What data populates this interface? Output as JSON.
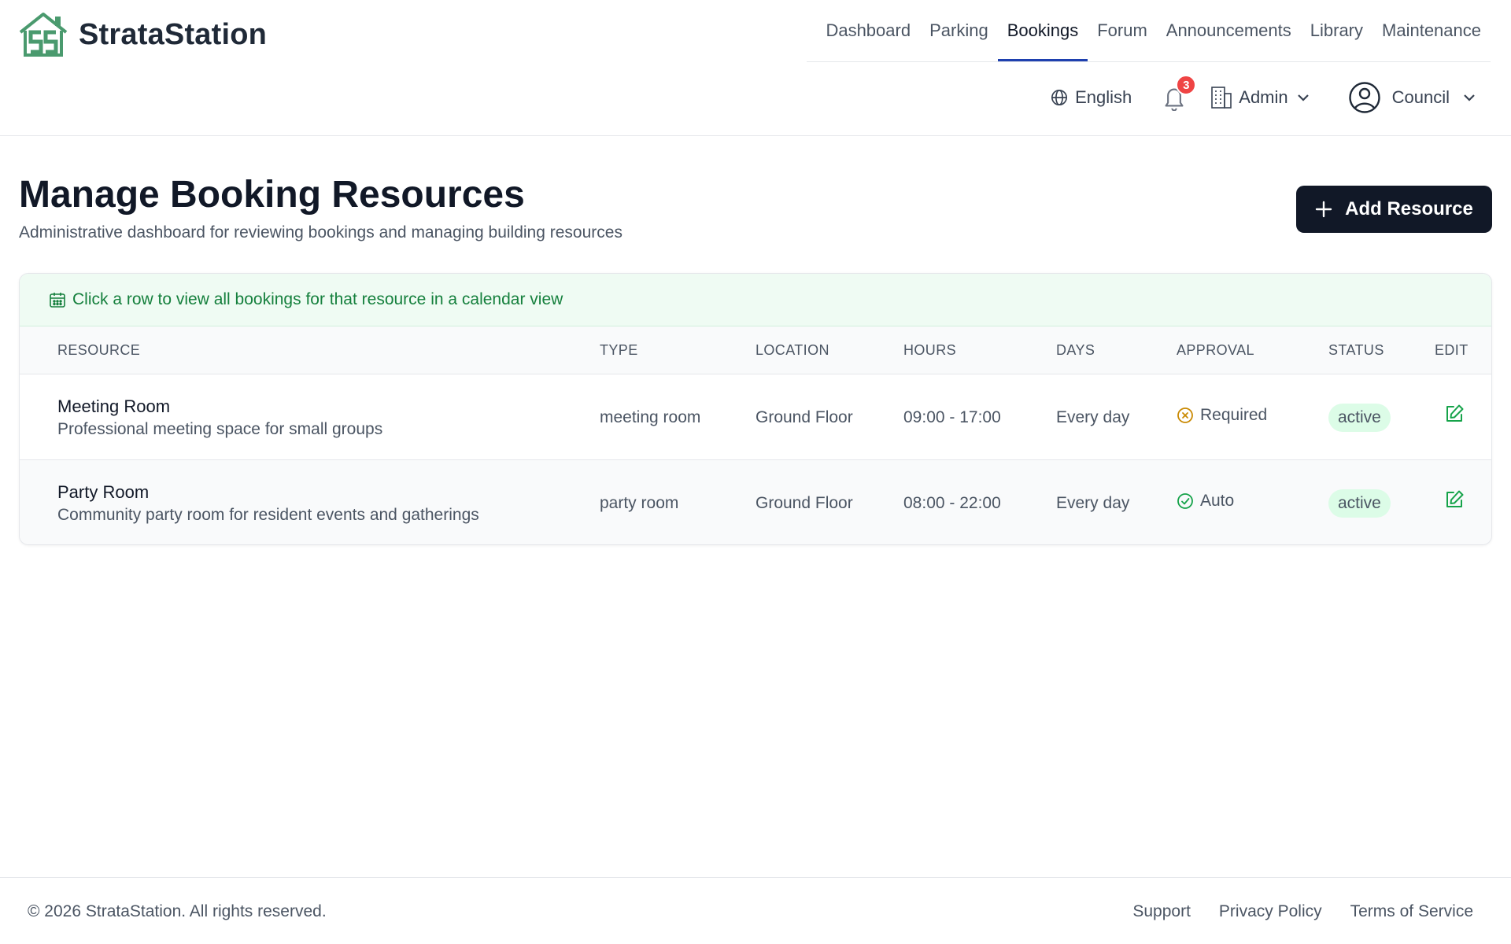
{
  "app": {
    "name": "StrataStation"
  },
  "nav": {
    "items": [
      {
        "label": "Dashboard"
      },
      {
        "label": "Parking"
      },
      {
        "label": "Bookings",
        "active": true
      },
      {
        "label": "Forum"
      },
      {
        "label": "Announcements"
      },
      {
        "label": "Library"
      },
      {
        "label": "Maintenance"
      }
    ]
  },
  "toolbar": {
    "language": "English",
    "notifications_count": "3",
    "building_role": "Admin",
    "user_role": "Council"
  },
  "page": {
    "title": "Manage Booking Resources",
    "subtitle": "Administrative dashboard for reviewing bookings and managing building resources",
    "add_button": "Add Resource"
  },
  "table": {
    "info": "Click a row to view all bookings for that resource in a calendar view",
    "headers": [
      "Resource",
      "Type",
      "Location",
      "Hours",
      "Days",
      "Approval",
      "Status",
      "Edit"
    ],
    "rows": [
      {
        "name": "Meeting Room",
        "description": "Professional meeting space for small groups",
        "type": "meeting room",
        "location": "Ground Floor",
        "hours": "09:00 - 17:00",
        "days": "Every day",
        "approval": "Required",
        "status": "active"
      },
      {
        "name": "Party Room",
        "description": "Community party room for resident events and gatherings",
        "type": "party room",
        "location": "Ground Floor",
        "hours": "08:00 - 22:00",
        "days": "Every day",
        "approval": "Auto",
        "status": "active"
      }
    ]
  },
  "footer": {
    "copyright": "© 2026 StrataStation. All rights reserved.",
    "links": [
      "Support",
      "Privacy Policy",
      "Terms of Service"
    ]
  },
  "colors": {
    "primary": "#111827",
    "nav_active_underline": "#1e40af",
    "approval_required": "#ca8a04",
    "approval_auto": "#16a34a",
    "info_bar_bg": "#effbf3",
    "status_active_bg": "#dcfce7",
    "badge": "#ef4444",
    "logo_green": "#4a9a6e"
  }
}
